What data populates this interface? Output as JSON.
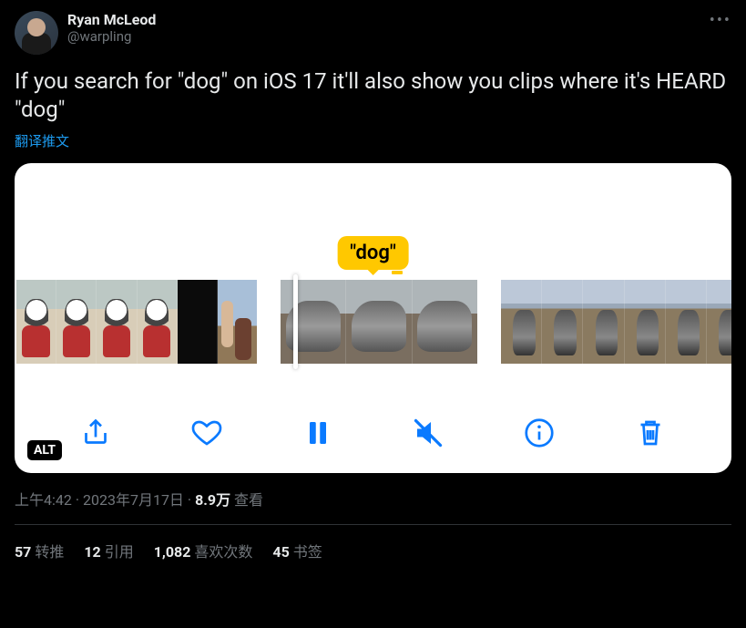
{
  "author": {
    "display_name": "Ryan McLeod",
    "handle": "@warpling"
  },
  "tweet_text": "If you search for \"dog\" on iOS 17 it'll also show you clips where it's HEARD \"dog\"",
  "translate_label": "翻译推文",
  "media": {
    "search_term": "\"dog\"",
    "alt_badge": "ALT",
    "toolbar": {
      "share": "share",
      "like": "like",
      "pause": "pause",
      "mute": "mute",
      "info": "info",
      "delete": "delete"
    }
  },
  "meta": {
    "time": "上午4:42",
    "date": "2023年7月17日",
    "separator": " · ",
    "views_count": "8.9万",
    "views_label": " 查看"
  },
  "stats": {
    "retweets": {
      "count": "57",
      "label": "转推"
    },
    "quotes": {
      "count": "12",
      "label": "引用"
    },
    "likes": {
      "count": "1,082",
      "label": "喜欢次数"
    },
    "bookmarks": {
      "count": "45",
      "label": "书签"
    }
  },
  "more_label": "•••"
}
